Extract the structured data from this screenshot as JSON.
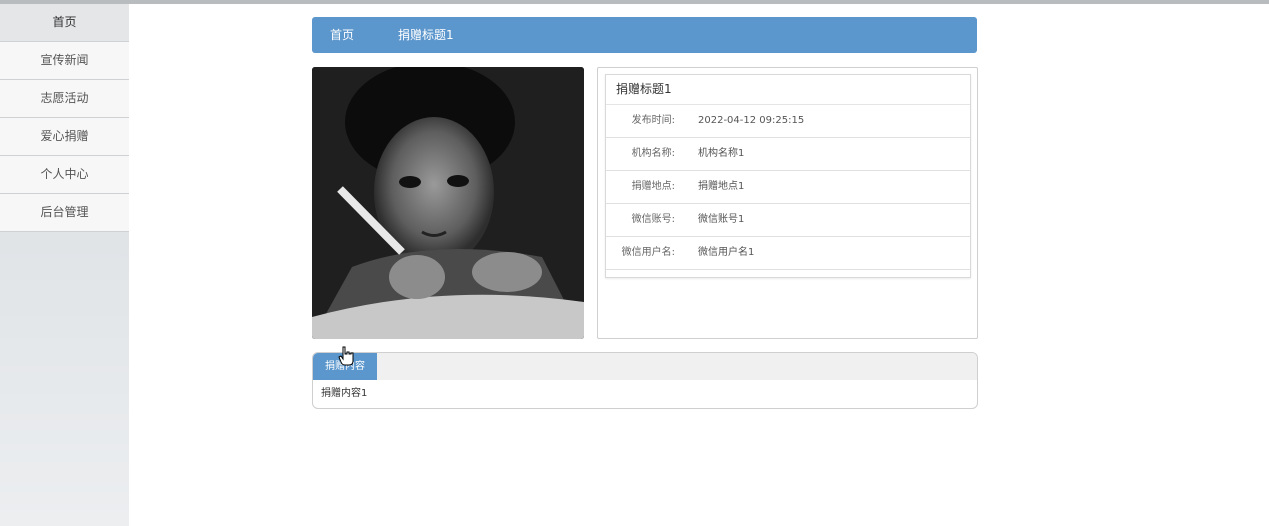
{
  "sidebar": {
    "items": [
      {
        "label": "首页"
      },
      {
        "label": "宣传新闻"
      },
      {
        "label": "志愿活动"
      },
      {
        "label": "爱心捐赠"
      },
      {
        "label": "个人中心"
      },
      {
        "label": "后台管理"
      }
    ]
  },
  "breadcrumb": {
    "home": "首页",
    "current": "捐赠标题1"
  },
  "detail": {
    "title": "捐赠标题1",
    "rows": [
      {
        "label": "发布时间:",
        "value": "2022-04-12 09:25:15"
      },
      {
        "label": "机构名称:",
        "value": "机构名称1"
      },
      {
        "label": "捐赠地点:",
        "value": "捐赠地点1"
      },
      {
        "label": "微信账号:",
        "value": "微信账号1"
      },
      {
        "label": "微信用户名:",
        "value": "微信用户名1"
      }
    ]
  },
  "content": {
    "tab_label": "捐赠内容",
    "text": "捐赠内容1"
  },
  "colors": {
    "accent": "#5b96cc"
  }
}
